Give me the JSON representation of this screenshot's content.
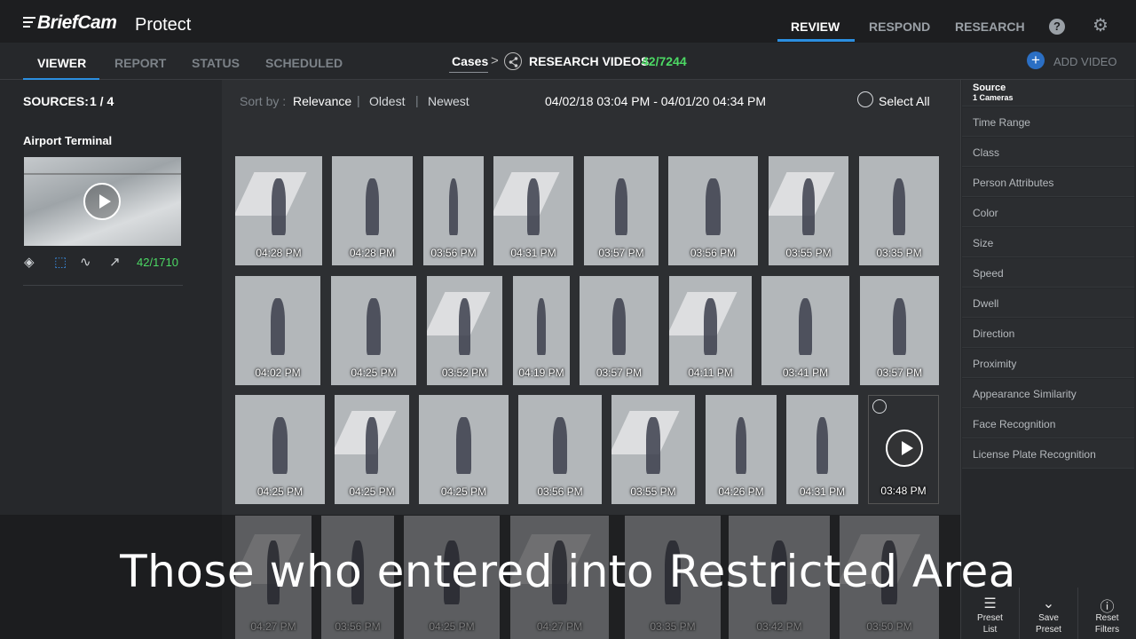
{
  "header": {
    "brand": "BriefCam",
    "product": "Protect",
    "nav": [
      "REVIEW",
      "RESPOND",
      "RESEARCH"
    ],
    "active_nav": "REVIEW"
  },
  "subnav": {
    "tabs": [
      "VIEWER",
      "REPORT",
      "STATUS",
      "SCHEDULED"
    ],
    "breadcrumb_cases": "Cases",
    "breadcrumb_sep": ">",
    "breadcrumb_current": "RESEARCH VIDEOS",
    "breadcrumb_count": "42/7244",
    "add_video": "ADD VIDEO"
  },
  "left": {
    "sources_label": "SOURCES:",
    "sources_count": "1 / 4",
    "camera_name": "Airport Terminal",
    "camera_count": "42/1710"
  },
  "sortbar": {
    "label": "Sort by :",
    "options": [
      "Relevance",
      "Oldest",
      "Newest"
    ],
    "date_range": "04/02/18 03:04 PM - 04/01/20 04:34 PM",
    "select_all": "Select All"
  },
  "results": [
    [
      "04:28 PM",
      "04:28 PM",
      "03:56 PM",
      "04:31 PM",
      "03:57 PM",
      "03:56 PM",
      "03:55 PM",
      "03:35 PM"
    ],
    [
      "04:02 PM",
      "04:25 PM",
      "03:52 PM",
      "04:19 PM",
      "03:57 PM",
      "04:11 PM",
      "03:41 PM",
      "03:57 PM"
    ],
    [
      "04:25 PM",
      "04:25 PM",
      "04:25 PM",
      "03:56 PM",
      "03:55 PM",
      "04:26 PM",
      "04:31 PM",
      "03:48 PM"
    ],
    [
      "04:27 PM",
      "03:56 PM",
      "04:25 PM",
      "04:27 PM",
      "03:35 PM",
      "03:42 PM",
      "03:50 PM"
    ]
  ],
  "filters": {
    "source_title": "Source",
    "source_sub": "1 Cameras",
    "items": [
      "Time Range",
      "Class",
      "Person Attributes",
      "Color",
      "Size",
      "Speed",
      "Dwell",
      "Direction",
      "Proximity",
      "Appearance Similarity",
      "Face Recognition",
      "License Plate Recognition"
    ]
  },
  "bottom_actions": [
    {
      "line1": "Preset",
      "line2": "List"
    },
    {
      "line1": "Save",
      "line2": "Preset"
    },
    {
      "line1": "Reset",
      "line2": "Filters"
    }
  ],
  "caption": "Those who entered into Restricted Area",
  "colors": {
    "accent": "#2b8fe0",
    "count_green": "#4cd964",
    "bg": "#2d2f32"
  }
}
